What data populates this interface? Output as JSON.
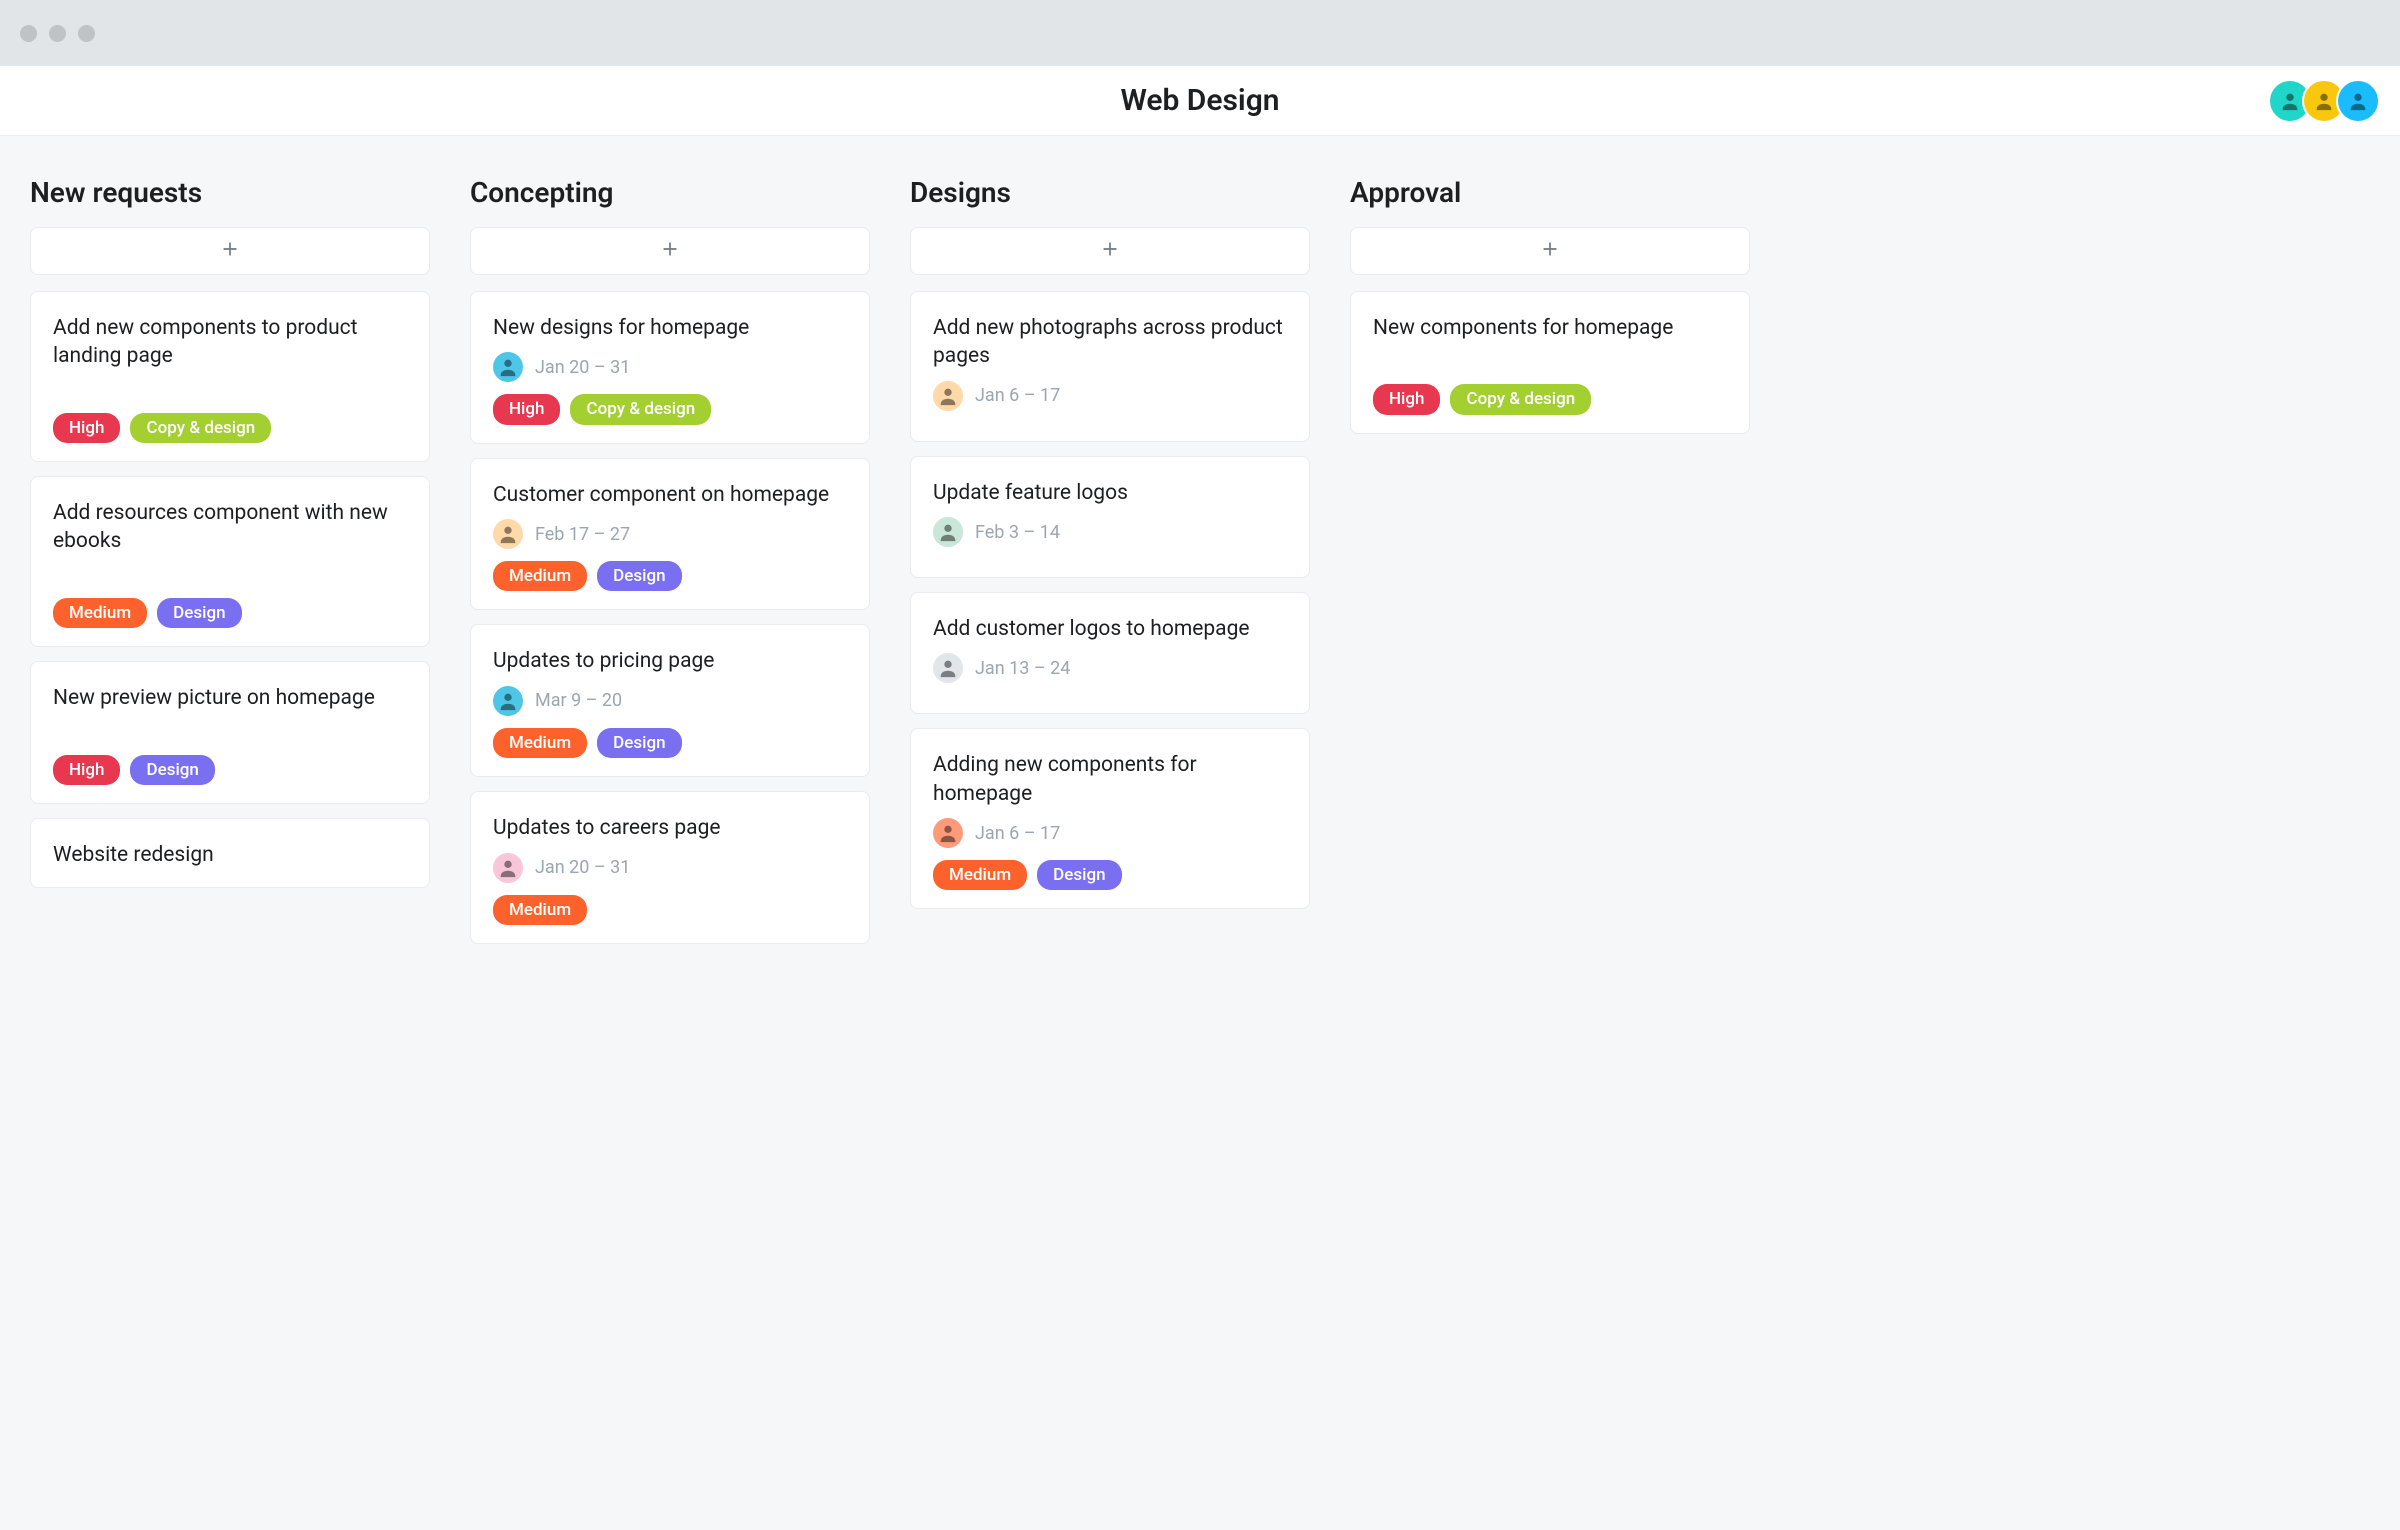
{
  "header": {
    "title": "Web Design"
  },
  "collaborators": [
    {
      "bg": "#1fd6c9"
    },
    {
      "bg": "#f9c80e"
    },
    {
      "bg": "#1abcfe"
    }
  ],
  "tag_colors": {
    "High": "#e8384f",
    "Medium": "#fd612c",
    "Design": "#7a6ff0",
    "Copy & design": "#a4cf30"
  },
  "assignee_colors": [
    "#4dc6e8",
    "#ffd9a8",
    "#fd9a7a",
    "#e0e6ea",
    "#c9e7d8",
    "#f7c6d9"
  ],
  "columns": [
    {
      "name": "New requests",
      "cards": [
        {
          "title": "Add new components to product landing page",
          "spacer": true,
          "tags": [
            "High",
            "Copy & design"
          ]
        },
        {
          "title": "Add resources component with new ebooks",
          "spacer": true,
          "tags": [
            "Medium",
            "Design"
          ]
        },
        {
          "title": "New preview picture on homepage",
          "spacer": true,
          "tags": [
            "High",
            "Design"
          ]
        },
        {
          "title": "Website redesign"
        }
      ]
    },
    {
      "name": "Concepting",
      "cards": [
        {
          "title": "New designs for homepage",
          "assignee_color": 0,
          "date": "Jan 20 – 31",
          "tags": [
            "High",
            "Copy & design"
          ]
        },
        {
          "title": "Customer component on homepage",
          "assignee_color": 1,
          "date": "Feb 17 – 27",
          "tags": [
            "Medium",
            "Design"
          ]
        },
        {
          "title": "Updates to pricing page",
          "assignee_color": 0,
          "date": "Mar 9 – 20",
          "tags": [
            "Medium",
            "Design"
          ]
        },
        {
          "title": "Updates to careers page",
          "assignee_color": 5,
          "date": "Jan 20 – 31",
          "tags": [
            "Medium"
          ]
        }
      ]
    },
    {
      "name": "Designs",
      "cards": [
        {
          "title": "Add new photographs across product pages",
          "assignee_color": 1,
          "date": "Jan 6 – 17"
        },
        {
          "title": "Update feature logos",
          "assignee_color": 4,
          "date": "Feb 3 – 14"
        },
        {
          "title": "Add customer logos to homepage",
          "assignee_color": 3,
          "date": "Jan 13 – 24"
        },
        {
          "title": "Adding new components for homepage",
          "assignee_color": 2,
          "date": "Jan 6 – 17",
          "tags": [
            "Medium",
            "Design"
          ]
        }
      ]
    },
    {
      "name": "Approval",
      "cards": [
        {
          "title": "New components for homepage",
          "spacer": true,
          "tags": [
            "High",
            "Copy & design"
          ]
        }
      ]
    }
  ]
}
